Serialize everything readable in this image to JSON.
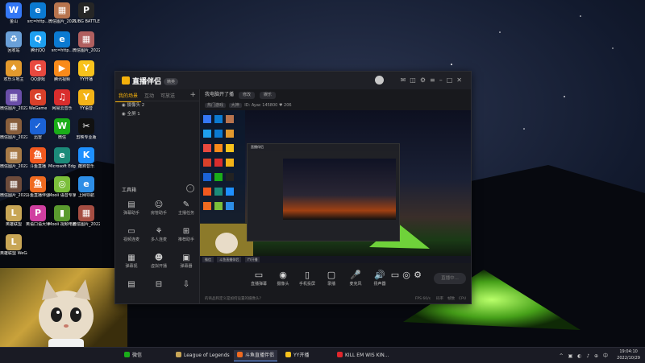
{
  "desktop": {
    "icons": [
      {
        "label": "金山",
        "glyph": "W",
        "color": "#3478f6"
      },
      {
        "label": "src=http...",
        "glyph": "e",
        "color": "#0b7ad1"
      },
      {
        "label": "微信图片_2022101...",
        "glyph": "▦",
        "color": "#b7744e"
      },
      {
        "label": "PUBG BATTLEGR...",
        "glyph": "P",
        "color": "#262626"
      },
      {
        "label": "回收站",
        "glyph": "♻",
        "color": "#6aa0d8"
      },
      {
        "label": "腾讯QQ",
        "glyph": "Q",
        "color": "#1ea0f0"
      },
      {
        "label": "src=http...",
        "glyph": "e",
        "color": "#0b7ad1"
      },
      {
        "label": "微信图片_2022101...",
        "glyph": "▦",
        "color": "#b05f5f"
      },
      {
        "label": "欢乐斗地主",
        "glyph": "♠",
        "color": "#e39a2d"
      },
      {
        "label": "QQ游戏",
        "glyph": "G",
        "color": "#e8493f"
      },
      {
        "label": "腾讯视频",
        "glyph": "▶",
        "color": "#f98a1a"
      },
      {
        "label": "YY开播",
        "glyph": "Y",
        "color": "#f8c21c"
      },
      {
        "label": "微信图片_2022101...",
        "glyph": "▦",
        "color": "#6a4ea8"
      },
      {
        "label": "WeGame",
        "glyph": "G",
        "color": "#d8402a"
      },
      {
        "label": "网易云音乐",
        "glyph": "♫",
        "color": "#d92d2d"
      },
      {
        "label": "YY语音",
        "glyph": "Y",
        "color": "#f3b317"
      },
      {
        "label": "微信图片_2022101...",
        "glyph": "▦",
        "color": "#885e3c"
      },
      {
        "label": "迅雷",
        "glyph": "✓",
        "color": "#1b62d6"
      },
      {
        "label": "微信",
        "glyph": "W",
        "color": "#1aad19"
      },
      {
        "label": "剪映专业版",
        "glyph": "✂",
        "color": "#111111"
      },
      {
        "label": "微信图片_2022101...",
        "glyph": "▦",
        "color": "#a77a47"
      },
      {
        "label": "斗鱼直播",
        "glyph": "鱼",
        "color": "#f2591f"
      },
      {
        "label": "Microsoft Edge",
        "glyph": "e",
        "color": "#1c8b7a"
      },
      {
        "label": "酷狗音乐",
        "glyph": "K",
        "color": "#1e90ff"
      },
      {
        "label": "微信图片_2022101...",
        "glyph": "▦",
        "color": "#6d4b3b"
      },
      {
        "label": "斗鱼直播伴侣",
        "glyph": "鱼",
        "color": "#ef6a20"
      },
      {
        "label": "Mooii 语音专家 1.43",
        "glyph": "◎",
        "color": "#7bbf3a"
      },
      {
        "label": "上网导航",
        "glyph": "e",
        "color": "#2d8ee6"
      },
      {
        "label": "英雄联盟",
        "glyph": "L",
        "color": "#c8a656"
      },
      {
        "label": "英语口语大师",
        "glyph": "P",
        "color": "#d03fa0"
      },
      {
        "label": "Mooii 视频电脑播 1.17",
        "glyph": "▮",
        "color": "#5a9a2e"
      },
      {
        "label": "微信图片_2022101...",
        "glyph": "▦",
        "color": "#a54d42"
      },
      {
        "label": "英雄联盟 WeGame版",
        "glyph": "L",
        "color": "#c8a656"
      }
    ]
  },
  "app": {
    "title": "直播伴侣",
    "version_badge": "精英",
    "left_tabs": [
      "我的场景",
      "互动",
      "可放送"
    ],
    "scenes": [
      "摄像头 2",
      "全屏 1"
    ],
    "tools_title": "工具箱",
    "tools": [
      {
        "label": "弹幕助手",
        "icon": "▤"
      },
      {
        "label": "房管助手",
        "icon": "☺"
      },
      {
        "label": "主播任务",
        "icon": "✎"
      },
      {
        "label": "视频连麦",
        "icon": "▭"
      },
      {
        "label": "多人连麦",
        "icon": "⚘"
      },
      {
        "label": "推荐助手",
        "icon": "⊞"
      },
      {
        "label": "弹幕视",
        "icon": "▦"
      },
      {
        "label": "虚拟开播",
        "icon": "☻"
      },
      {
        "label": "弹幕器",
        "icon": "▣"
      },
      {
        "label": "",
        "icon": "▤"
      },
      {
        "label": "",
        "icon": "⊟"
      },
      {
        "label": "",
        "icon": "⇩"
      }
    ],
    "room_title": "我电脑开了播",
    "room_pills": [
      "修改",
      "娱乐"
    ],
    "room_sub": [
      "热门游戏",
      "大神"
    ],
    "room_meta": "ID:  Ayac  145800",
    "room_fans": "206",
    "bottom_tools": [
      {
        "label": "直播弹幕",
        "icon": "▭"
      },
      {
        "label": "摄像头",
        "icon": "◉"
      },
      {
        "label": "手机投屏",
        "icon": "▯"
      },
      {
        "label": "录播",
        "icon": "▢"
      },
      {
        "label": "麦克风",
        "icon": "🎤"
      },
      {
        "label": "扬声器",
        "icon": "🔊"
      }
    ],
    "go_live": "直播中...",
    "status_hint": "的商品和定义是如何设置的摄像头?",
    "status_right": [
      "FPS 60/s",
      "码率",
      "帧数",
      "CPU"
    ]
  },
  "taskbar": {
    "items": [
      {
        "label": "微信",
        "color": "#1aad19",
        "active": false
      },
      {
        "label": "League of Legends",
        "color": "#c8a656",
        "active": false
      },
      {
        "label": "斗鱼直播伴侣",
        "color": "#ef6a20",
        "active": true
      },
      {
        "label": "YY开播",
        "color": "#f8c21c",
        "active": false
      },
      {
        "label": "KILL EM WIS KIN...",
        "color": "#e1262c",
        "active": false
      }
    ],
    "tray": "^ ▣ ◐ ♪ ⊕ 中",
    "time": "19:04:10",
    "date": "2022/10/29"
  }
}
